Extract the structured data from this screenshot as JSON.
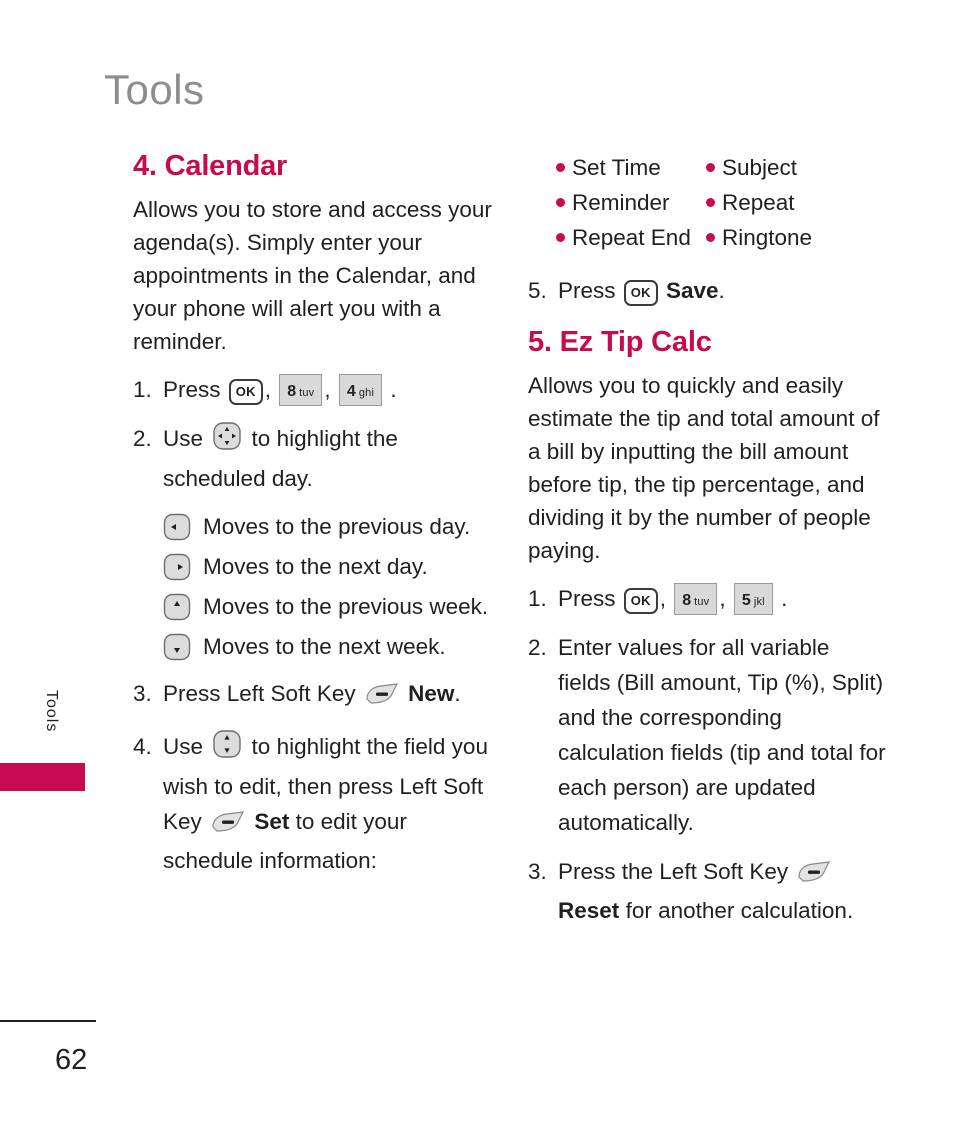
{
  "running_head": "Tools",
  "side_tab": {
    "label": "Tools",
    "color": "#c80a50"
  },
  "footer": {
    "page_number": "62"
  },
  "accent_color": "#c80a50",
  "left_column": {
    "heading": "4. Calendar",
    "intro": "Allows you to store and access your agenda(s). Simply enter your appointments in the Calendar, and your phone will alert you with a reminder.",
    "steps": [
      {
        "num": "1.",
        "pre": "Press",
        "keys": [
          "OK",
          "8 tuv",
          "4 ghi"
        ],
        "post": "."
      },
      {
        "num": "2.",
        "pre": "Use",
        "nav_key": "five-way-navigation-key",
        "post": "to highlight the scheduled day."
      },
      {
        "num": "3.",
        "pre": "Press Left Soft Key",
        "softkey": "left-soft-key",
        "bold": "New",
        "post": "."
      },
      {
        "num": "4.",
        "pre": "Use",
        "nav_key": "up-down-navigation-key",
        "mid": "to highlight the field you wish to edit, then press Left Soft Key",
        "softkey": "left-soft-key",
        "bold": "Set",
        "post": "to edit your schedule information:"
      }
    ],
    "direction_keys": [
      {
        "icon": "arrow-left-key",
        "text": "Moves to the previous day."
      },
      {
        "icon": "arrow-right-key",
        "text": "Moves to the next day."
      },
      {
        "icon": "arrow-up-key",
        "text": "Moves to the previous week."
      },
      {
        "icon": "arrow-down-key",
        "text": "Moves to the next week."
      }
    ]
  },
  "right_column": {
    "bullets_left": [
      "Set Time",
      "Reminder",
      "Repeat End"
    ],
    "bullets_right": [
      "Subject",
      "Repeat",
      "Ringtone"
    ],
    "save_step": {
      "num": "5.",
      "pre": "Press",
      "key": "OK",
      "bold": "Save",
      "post": "."
    },
    "heading": "5. Ez Tip Calc",
    "intro": "Allows you to quickly and easily estimate the tip and total amount of a bill by inputting the bill amount before tip, the tip percentage, and dividing it by the number of people paying.",
    "steps": [
      {
        "num": "1.",
        "pre": "Press",
        "keys": [
          "OK",
          "8 tuv",
          "5 jkl"
        ],
        "post": "."
      },
      {
        "num": "2.",
        "text": "Enter values for all variable fields (Bill amount, Tip (%), Split) and the corresponding calculation fields (tip and total for each person) are updated automatically."
      },
      {
        "num": "3.",
        "pre": "Press the Left Soft Key",
        "softkey": "left-soft-key",
        "bold": "Reset",
        "post": "for another calculation."
      }
    ]
  },
  "keys": {
    "ok": "OK",
    "eight": {
      "digit": "8",
      "letters": "tuv"
    },
    "four": {
      "digit": "4",
      "letters": "ghi"
    },
    "five": {
      "digit": "5",
      "letters": "jkl"
    }
  }
}
